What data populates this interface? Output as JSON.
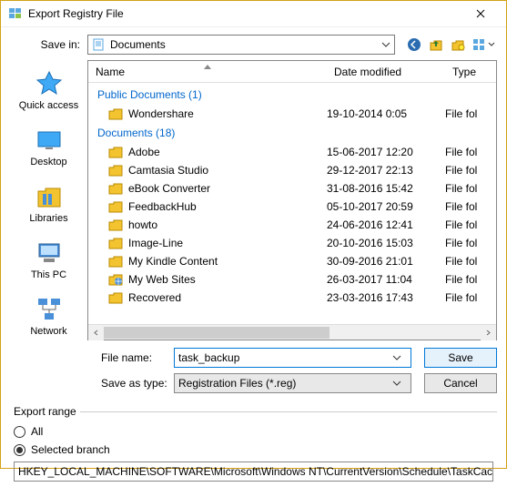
{
  "window": {
    "title": "Export Registry File"
  },
  "savein": {
    "label": "Save in:",
    "value": "Documents"
  },
  "nav_icons": [
    "back-icon",
    "up-icon",
    "new-folder-icon",
    "view-icon"
  ],
  "places": [
    {
      "name": "quick-access",
      "label": "Quick access"
    },
    {
      "name": "desktop",
      "label": "Desktop"
    },
    {
      "name": "libraries",
      "label": "Libraries"
    },
    {
      "name": "this-pc",
      "label": "This PC"
    },
    {
      "name": "network",
      "label": "Network"
    }
  ],
  "columns": {
    "name": "Name",
    "date": "Date modified",
    "type": "Type"
  },
  "groups": [
    {
      "title": "Public Documents (1)",
      "items": [
        {
          "name": "Wondershare",
          "date": "19-10-2014 0:05",
          "type": "File fol"
        }
      ]
    },
    {
      "title": "Documents (18)",
      "items": [
        {
          "name": "Adobe",
          "date": "15-06-2017 12:20",
          "type": "File fol"
        },
        {
          "name": "Camtasia Studio",
          "date": "29-12-2017 22:13",
          "type": "File fol"
        },
        {
          "name": "eBook Converter",
          "date": "31-08-2016 15:42",
          "type": "File fol"
        },
        {
          "name": "FeedbackHub",
          "date": "05-10-2017 20:59",
          "type": "File fol"
        },
        {
          "name": "howto",
          "date": "24-06-2016 12:41",
          "type": "File fol"
        },
        {
          "name": "Image-Line",
          "date": "20-10-2016 15:03",
          "type": "File fol"
        },
        {
          "name": "My Kindle Content",
          "date": "30-09-2016 21:01",
          "type": "File fol"
        },
        {
          "name": "My Web Sites",
          "date": "26-03-2017 11:04",
          "type": "File fol",
          "icon": "web"
        },
        {
          "name": "Recovered",
          "date": "23-03-2016 17:43",
          "type": "File fol"
        }
      ]
    }
  ],
  "filename": {
    "label": "File name:",
    "value": "task_backup"
  },
  "saveastype": {
    "label": "Save as type:",
    "value": "Registration Files (*.reg)"
  },
  "buttons": {
    "save": "Save",
    "cancel": "Cancel"
  },
  "export_range": {
    "legend": "Export range",
    "all": "All",
    "selected": "Selected branch",
    "branch_path": "HKEY_LOCAL_MACHINE\\SOFTWARE\\Microsoft\\Windows NT\\CurrentVersion\\Schedule\\TaskCache"
  }
}
